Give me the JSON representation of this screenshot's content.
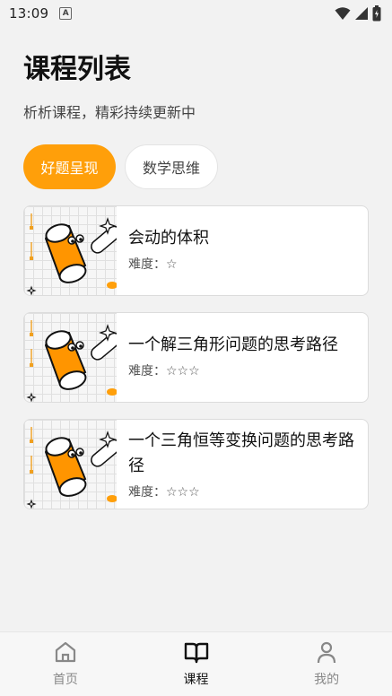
{
  "status_bar": {
    "time": "13:09",
    "keyboard_badge": "A"
  },
  "page": {
    "title": "课程列表",
    "subtitle": "析析课程，精彩持续更新中"
  },
  "tabs": [
    {
      "label": "好题呈现",
      "active": true
    },
    {
      "label": "数学思维",
      "active": false
    }
  ],
  "difficulty_label": "难度：",
  "courses": [
    {
      "title": "会动的体积",
      "stars": "☆"
    },
    {
      "title": "一个解三角形问题的思考路径",
      "stars": "☆☆☆"
    },
    {
      "title": "一个三角恒等变换问题的思考路径",
      "stars": "☆☆☆"
    }
  ],
  "bottom_nav": [
    {
      "label": "首页",
      "icon": "home-icon",
      "active": false
    },
    {
      "label": "课程",
      "icon": "book-icon",
      "active": true
    },
    {
      "label": "我的",
      "icon": "person-icon",
      "active": false
    }
  ],
  "colors": {
    "accent": "#ff9f0a",
    "background": "#f2f2f2"
  }
}
